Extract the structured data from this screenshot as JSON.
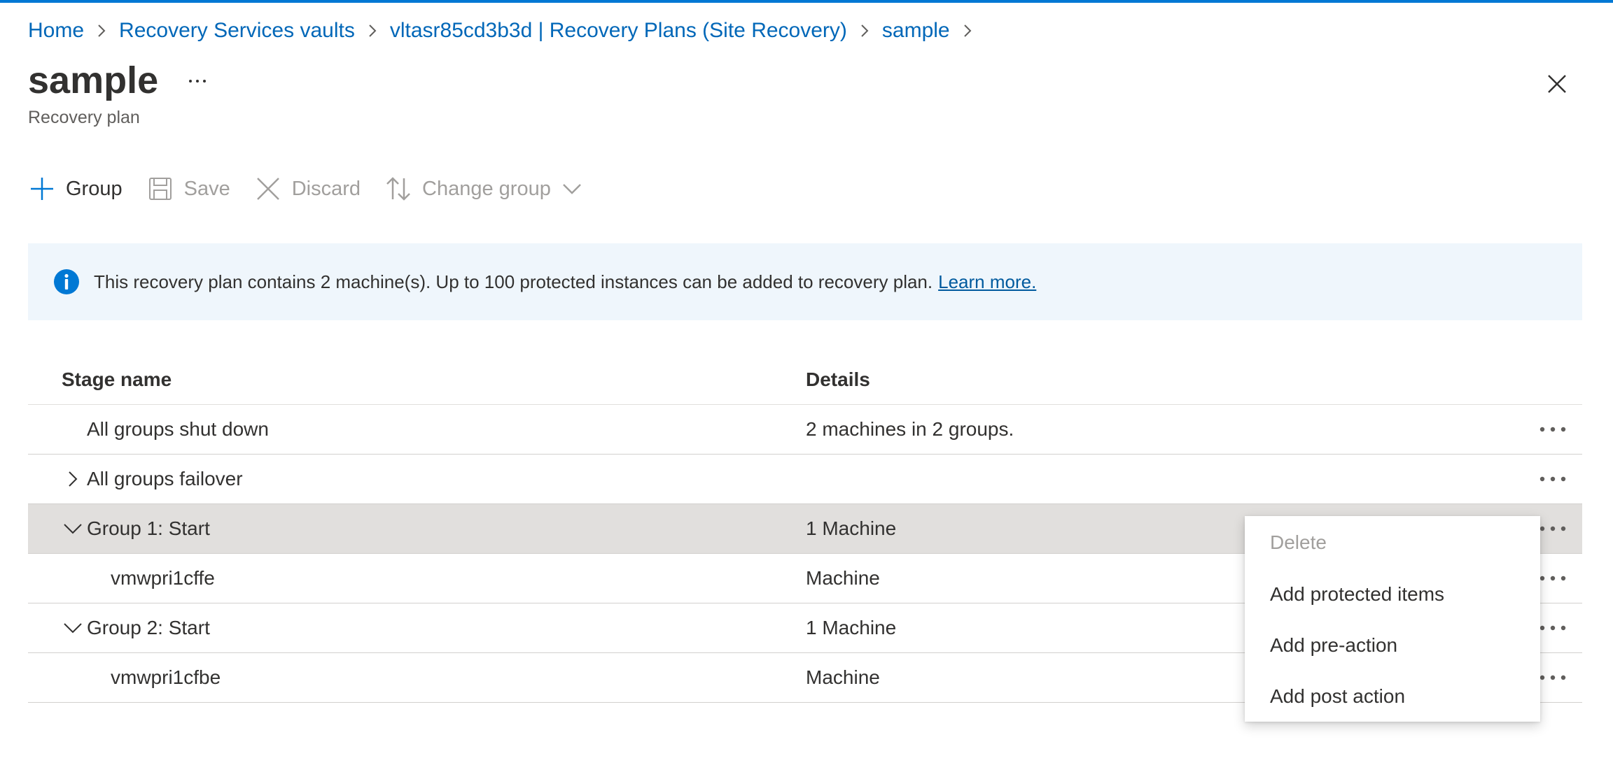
{
  "breadcrumb": [
    {
      "label": "Home"
    },
    {
      "label": "Recovery Services vaults"
    },
    {
      "label": "vltasr85cd3b3d | Recovery Plans (Site Recovery)"
    },
    {
      "label": "sample"
    }
  ],
  "header": {
    "title": "sample",
    "more_label": "...",
    "subtitle": "Recovery plan"
  },
  "toolbar": {
    "group_label": "Group",
    "save_label": "Save",
    "discard_label": "Discard",
    "change_group_label": "Change group"
  },
  "banner": {
    "text": "This recovery plan contains 2 machine(s). Up to 100 protected instances can be added to recovery plan.",
    "link": "Learn more."
  },
  "table": {
    "columns": [
      "Stage name",
      "Details"
    ],
    "rows": [
      {
        "stage": "All groups shut down",
        "details": "2 machines in 2 groups.",
        "expander": "none"
      },
      {
        "stage": "All groups failover",
        "details": "",
        "expander": "collapsed"
      },
      {
        "stage": "Group 1: Start",
        "details": "1 Machine",
        "expander": "expanded",
        "selected": true
      },
      {
        "stage": "vmwpri1cffe",
        "details": "Machine",
        "expander": "none"
      },
      {
        "stage": "Group 2: Start",
        "details": "1 Machine",
        "expander": "expanded"
      },
      {
        "stage": "vmwpri1cfbe",
        "details": "Machine",
        "expander": "none"
      }
    ]
  },
  "context_menu": {
    "items": [
      {
        "label": "Delete",
        "disabled": true
      },
      {
        "label": "Add protected items",
        "disabled": false
      },
      {
        "label": "Add pre-action",
        "disabled": false
      },
      {
        "label": "Add post action",
        "disabled": false
      }
    ]
  },
  "colors": {
    "accent": "#0078d4",
    "link": "#0067b8",
    "banner_bg": "#eff6fc",
    "selected_row": "#e1dfdd",
    "disabled_text": "#a19f9d"
  },
  "icons": [
    "chevron-right-icon",
    "more-icon",
    "close-icon",
    "plus-icon",
    "save-icon",
    "discard-icon",
    "swap-icon",
    "chevron-down-icon",
    "info-icon"
  ]
}
